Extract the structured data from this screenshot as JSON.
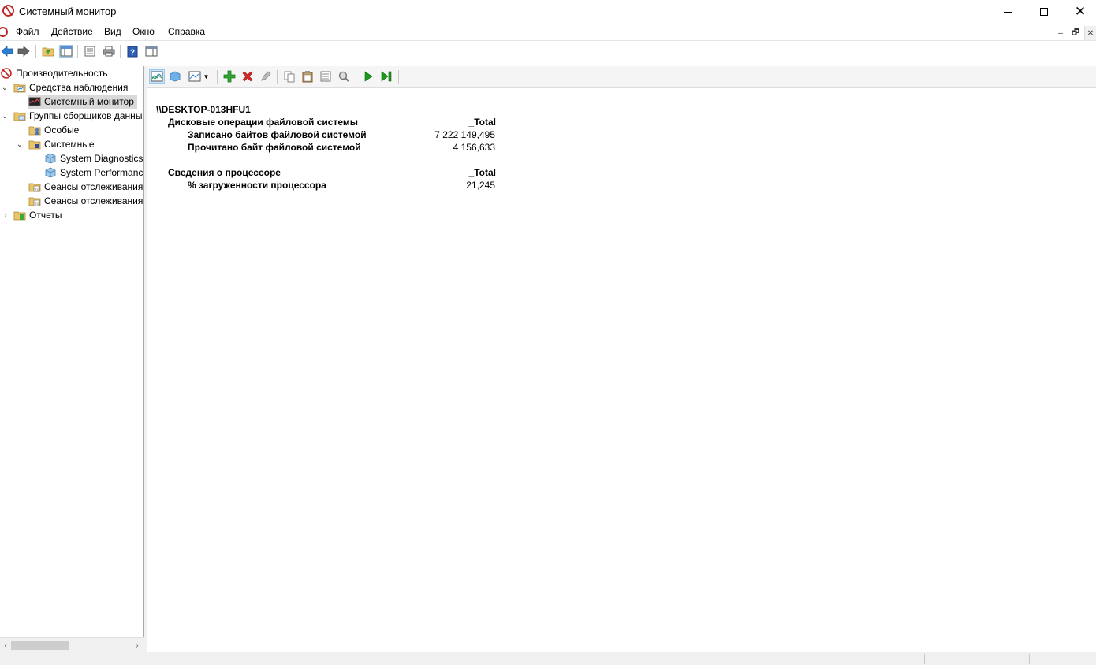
{
  "window": {
    "title": "Системный монитор",
    "minimize_label": "–",
    "close_label": "✕"
  },
  "menu": [
    "Файл",
    "Действие",
    "Вид",
    "Окно",
    "Справка"
  ],
  "mdi_controls": [
    "–",
    "🗗",
    "✕"
  ],
  "tree": {
    "root": "Производительность",
    "monitoring_tools": "Средства наблюдения",
    "system_monitor": "Системный монитор",
    "collector_sets": "Группы сборщиков данных",
    "user_defined": "Особые",
    "system": "Системные",
    "system_diagnostics": "System Diagnostics",
    "system_performance": "System Performance",
    "event_trace_1": "Сеансы отслеживания событий",
    "event_trace_2": "Сеансы отслеживания событий запуска",
    "reports": "Отчеты"
  },
  "report": {
    "computer": "\\\\DESKTOP-013HFU1",
    "sections": [
      {
        "name": "Дисковые операции файловой системы",
        "instance": "_Total",
        "counters": [
          {
            "name": "Записано байтов файловой системой",
            "value": "7 222 149,495"
          },
          {
            "name": "Прочитано байт файловой системой",
            "value": "4 156,633"
          }
        ]
      },
      {
        "name": "Сведения о процессоре",
        "instance": "_Total",
        "counters": [
          {
            "name": "% загруженности процессора",
            "value": "21,245"
          }
        ]
      }
    ]
  },
  "colors": {
    "accent_red": "#c02828",
    "add_green": "#2fa52f",
    "delete_red": "#d22a2a",
    "play_green": "#1a9a1a",
    "nav_blue": "#2a7fd4",
    "selection_gray": "#d9d9d9"
  }
}
